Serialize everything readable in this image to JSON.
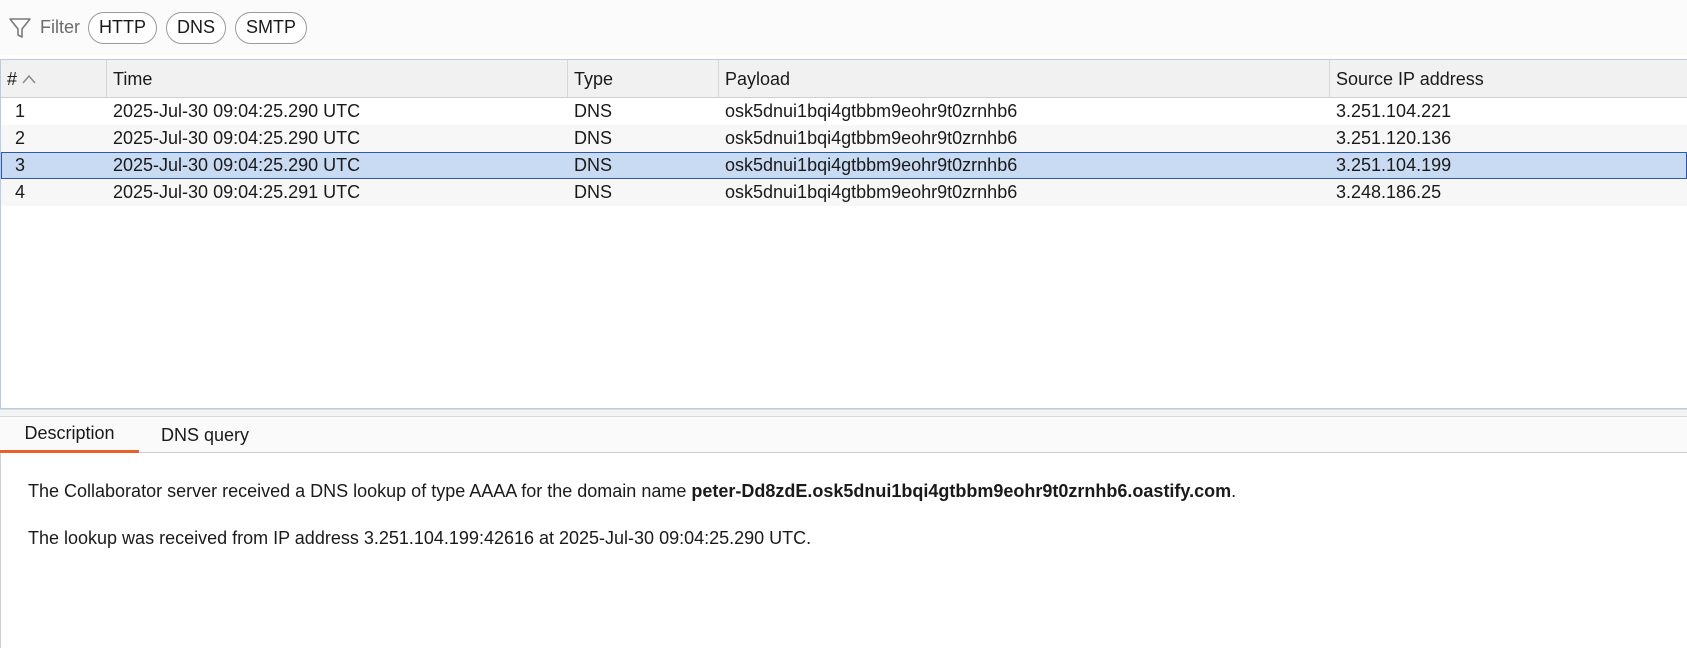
{
  "filter": {
    "label": "Filter",
    "chips": [
      "HTTP",
      "DNS",
      "SMTP"
    ]
  },
  "table": {
    "columns": [
      "#",
      "Time",
      "Type",
      "Payload",
      "Source IP address"
    ],
    "rows": [
      {
        "num": "1",
        "time": "2025-Jul-30 09:04:25.290 UTC",
        "type": "DNS",
        "payload": "osk5dnui1bqi4gtbbm9eohr9t0zrnhb6",
        "source_ip": "3.251.104.221"
      },
      {
        "num": "2",
        "time": "2025-Jul-30 09:04:25.290 UTC",
        "type": "DNS",
        "payload": "osk5dnui1bqi4gtbbm9eohr9t0zrnhb6",
        "source_ip": "3.251.120.136"
      },
      {
        "num": "3",
        "time": "2025-Jul-30 09:04:25.290 UTC",
        "type": "DNS",
        "payload": "osk5dnui1bqi4gtbbm9eohr9t0zrnhb6",
        "source_ip": "3.251.104.199"
      },
      {
        "num": "4",
        "time": "2025-Jul-30 09:04:25.291 UTC",
        "type": "DNS",
        "payload": "osk5dnui1bqi4gtbbm9eohr9t0zrnhb6",
        "source_ip": "3.248.186.25"
      }
    ],
    "selected_row": "3"
  },
  "detail": {
    "tabs": [
      "Description",
      "DNS query"
    ],
    "active_tab": "Description",
    "line1_prefix": "The Collaborator server received a DNS lookup of type AAAA for the domain name ",
    "line1_domain": "peter-Dd8zdE.osk5dnui1bqi4gtbbm9eohr9t0zrnhb6.oastify.com",
    "line1_suffix": ".",
    "line2": "The lookup was received from IP address 3.251.104.199:42616 at 2025-Jul-30 09:04:25.290 UTC."
  },
  "colors": {
    "selected_row": "#c9daf3",
    "selected_border": "#2b5aa8",
    "active_tab_underline": "#e8602c"
  }
}
